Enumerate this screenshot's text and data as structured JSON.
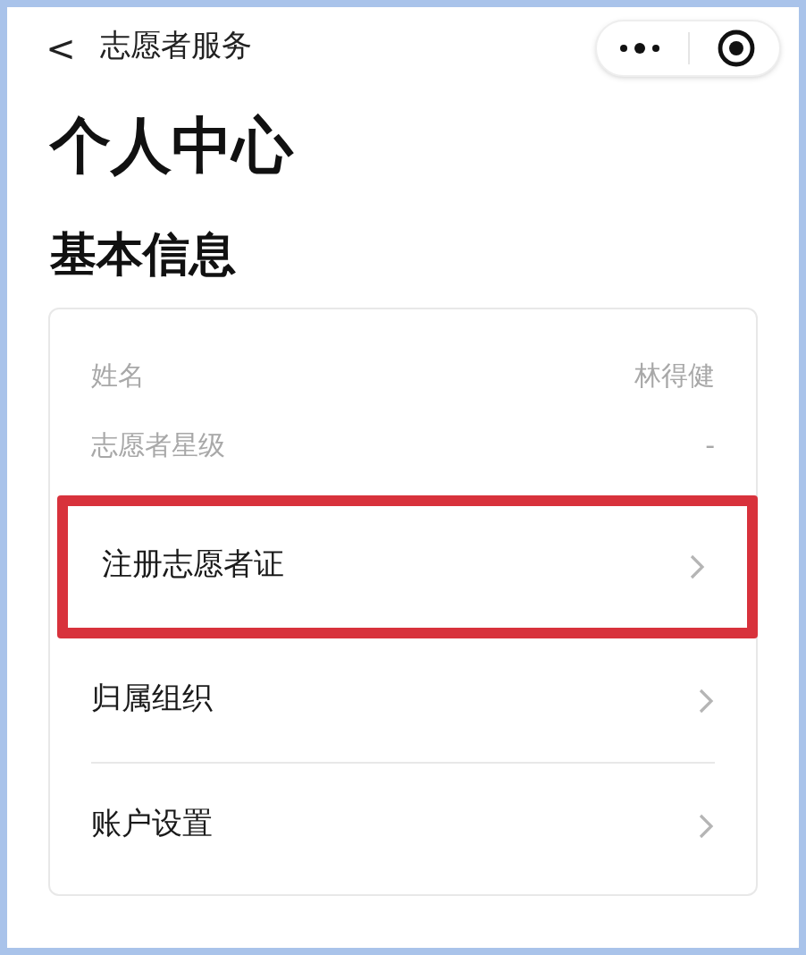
{
  "nav": {
    "back": "<",
    "title": "志愿者服务"
  },
  "page_title": "个人中心",
  "section_title": "基本信息",
  "info_rows": [
    {
      "label": "姓名",
      "value": "林得健"
    },
    {
      "label": "志愿者星级",
      "value": "-"
    }
  ],
  "menu_items": [
    {
      "label": "注册志愿者证",
      "highlighted": true
    },
    {
      "label": "归属组织",
      "highlighted": false
    },
    {
      "label": "账户设置",
      "highlighted": false
    }
  ]
}
